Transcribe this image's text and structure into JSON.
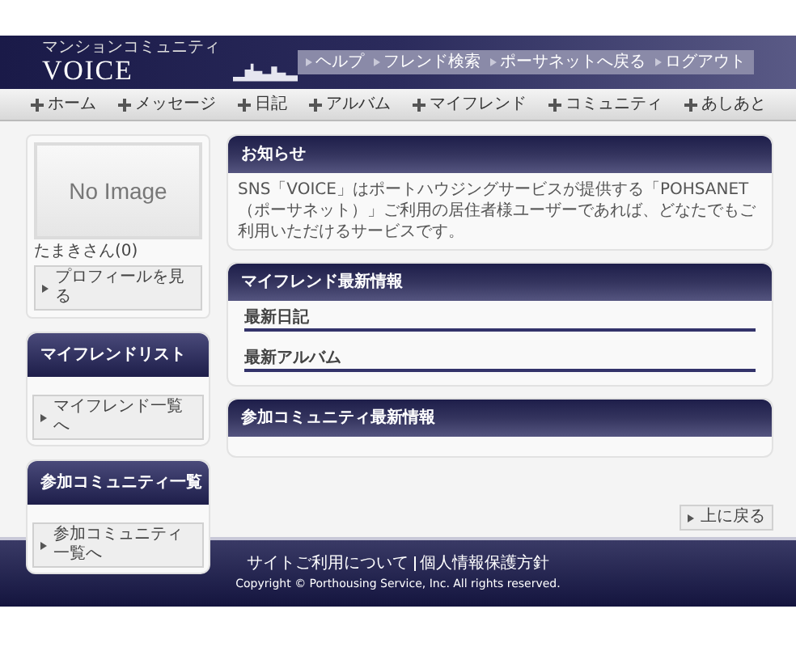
{
  "header": {
    "logo_subtitle": "マンションコミュニティ",
    "logo": "VOICE",
    "links": [
      "ヘルプ",
      "フレンド検索",
      "ポーサネットへ戻る",
      "ログアウト"
    ]
  },
  "nav": [
    "ホーム",
    "メッセージ",
    "日記",
    "アルバム",
    "マイフレンド",
    "コミュニティ",
    "あしあと"
  ],
  "profile": {
    "image_text": "No Image",
    "name": "たまきさん(0)",
    "button": "プロフィールを見る"
  },
  "friend_list": {
    "title": "マイフレンドリスト",
    "button": "マイフレンド一覧へ"
  },
  "community_list": {
    "title": "参加コミュニティ一覧",
    "button": "参加コミュニティ一覧へ"
  },
  "notice": {
    "title": "お知らせ",
    "text": "SNS「VOICE」はポートハウジングサービスが提供する「POHSANET（ポーサネット）」ご利用の居住者様ユーザーであれば、どなたでもご利用いただけるサービスです。"
  },
  "friend_updates": {
    "title": "マイフレンド最新情報",
    "sections": [
      "最新日記",
      "最新アルバム"
    ]
  },
  "community_updates": {
    "title": "参加コミュニティ最新情報"
  },
  "back_to_top": "上に戻る",
  "footer": {
    "links": [
      "サイトご利用について",
      "個人情報保護方針"
    ],
    "copyright": "Copyright © Porthousing Service, Inc. All rights reserved."
  }
}
